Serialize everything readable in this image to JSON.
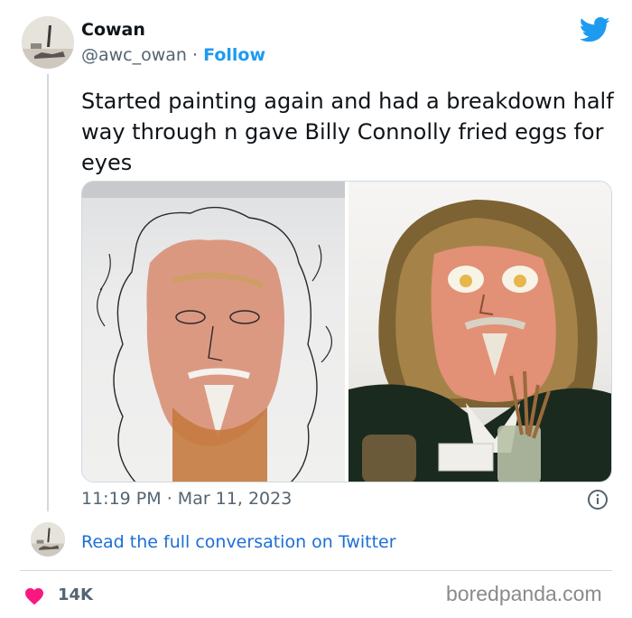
{
  "tweet": {
    "author_name": "Cowan",
    "handle": "@awc_owan",
    "separator": "·",
    "follow_label": "Follow",
    "text": "Started painting again and had a breakdown half way through n gave Billy Connolly fried eggs for eyes",
    "time": "11:19 PM",
    "date": "Mar 11, 2023"
  },
  "conversation": {
    "link_text": "Read the full conversation on Twitter"
  },
  "engagement": {
    "likes": "14K"
  },
  "watermark": "boredpanda.com",
  "colors": {
    "twitter_blue": "#1d9bf0",
    "link_blue": "#1d6ed8",
    "heart_pink": "#f91880",
    "muted_text": "#536471"
  },
  "icons": [
    "twitter-bird-icon",
    "info-icon",
    "heart-icon"
  ]
}
